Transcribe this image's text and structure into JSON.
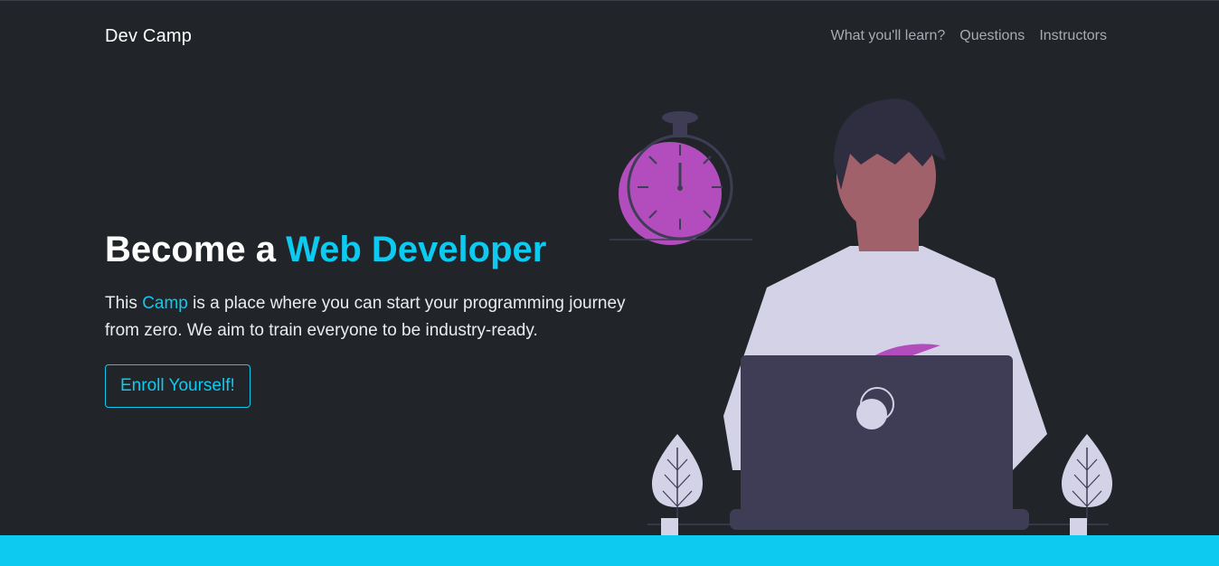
{
  "nav": {
    "brand": "Dev Camp",
    "links": [
      "What you'll learn?",
      "Questions",
      "Instructors"
    ]
  },
  "hero": {
    "title_prefix": "Become a ",
    "title_accent": "Web Developer",
    "lead_prefix": "This ",
    "lead_accent": "Camp",
    "lead_suffix": " is a place where you can start your programming journey from zero. We aim to train everyone to be industry-ready.",
    "cta_label": "Enroll Yourself!"
  },
  "colors": {
    "background": "#212529",
    "accent": "#0dcaf0",
    "stopwatch_fill": "#b34dbd",
    "laptop": "#3f3d56",
    "shirt": "#d4d2e6",
    "skin": "#a0616a"
  },
  "illustration": {
    "icons": [
      "stopwatch-icon",
      "person-icon",
      "laptop-icon",
      "plant-icon"
    ]
  }
}
